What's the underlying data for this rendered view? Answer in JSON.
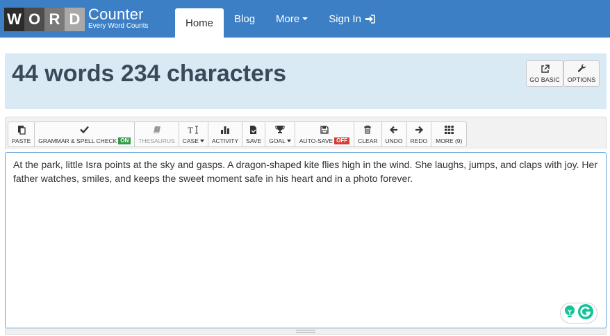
{
  "logo": {
    "letters": [
      "W",
      "O",
      "R",
      "D"
    ],
    "name": "Counter",
    "tagline": "Every Word Counts"
  },
  "nav": {
    "items": [
      {
        "label": "Home",
        "active": true
      },
      {
        "label": "Blog"
      },
      {
        "label": "More"
      },
      {
        "label": "Sign In"
      }
    ]
  },
  "header": {
    "count_text": "44 words 234 characters",
    "go_basic_label": "GO BASIC",
    "options_label": "OPTIONS"
  },
  "toolbar": {
    "paste": "PASTE",
    "grammar": "GRAMMAR & SPELL CHECK",
    "grammar_state": "ON",
    "thesaurus": "THESAURUS",
    "case": "CASE",
    "activity": "ACTIVITY",
    "save": "SAVE",
    "goal": "GOAL",
    "autosave": "AUTO-SAVE",
    "autosave_state": "OFF",
    "clear": "CLEAR",
    "undo": "UNDO",
    "redo": "REDO",
    "more": "MORE (9)"
  },
  "editor": {
    "text": "At the park, little Isra points at the sky and gasps. A dragon-shaped kite flies high in the wind. She laughs, jumps, and claps with joy. Her father watches, smiles, and keeps the sweet moment safe in his heart and in a photo forever."
  },
  "colors": {
    "navbar": "#3d7fc4",
    "panel": "#d9eaf5",
    "badge_on": "#2e9d46",
    "badge_off": "#d23d35",
    "grammarly": "#15c39a"
  }
}
